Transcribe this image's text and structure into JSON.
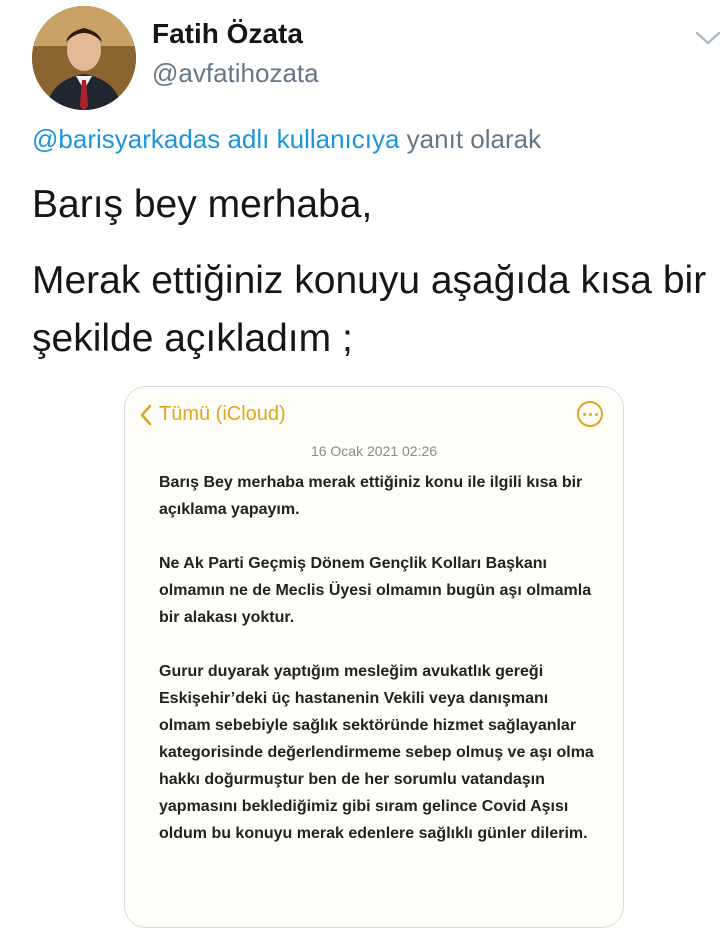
{
  "author": {
    "name": "Fatih Özata",
    "handle": "@avfatihozata"
  },
  "reply": {
    "mention": "@barisyarkadas adlı kullanıcıya",
    "suffix": " yanıt olarak"
  },
  "tweet": {
    "line1": "Barış bey merhaba,",
    "line2": "Merak ettiğiniz konuyu aşağıda kısa bir şekilde açıkladım ;"
  },
  "note": {
    "back_label": "Tümü (iCloud)",
    "date": "16 Ocak 2021 02:26",
    "paragraphs": [
      "Barış Bey merhaba merak ettiğiniz konu ile ilgili kısa bir açıklama yapayım.",
      "Ne Ak Parti Geçmiş Dönem Gençlik Kolları Başkanı olmamın ne de Meclis Üyesi olmamın bugün aşı olmamla bir alakası yoktur.",
      "Gurur duyarak yaptığım mesleğim avukatlık gereği Eskişehir’deki üç hastanenin  Vekili veya danışmanı olmam sebebiyle sağlık sektöründe hizmet sağlayanlar kategorisinde değerlendirmeme sebep olmuş ve aşı olma hakkı doğurmuştur ben de her sorumlu vatandaşın yapmasını beklediğimiz gibi sıram gelince Covid Aşısı oldum bu konuyu merak edenlere sağlıklı günler dilerim."
    ]
  },
  "colors": {
    "accent_link": "#1b95e0",
    "notes_yellow": "#e0a51e",
    "muted": "#657786"
  },
  "icons": {
    "menu": "chevron-down-icon",
    "back": "chevron-left-icon",
    "more": "ellipsis-circle-icon"
  }
}
